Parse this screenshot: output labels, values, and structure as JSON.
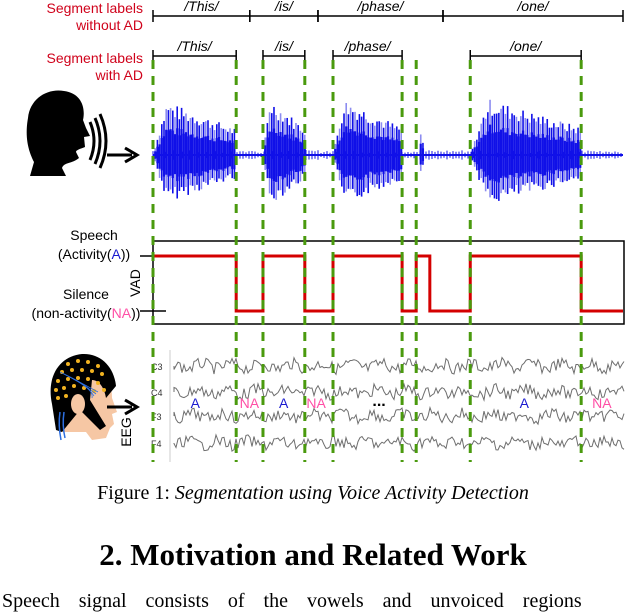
{
  "figure": {
    "row_labels": {
      "without_ad": [
        "Segment labels",
        "without AD"
      ],
      "with_ad": [
        "Segment labels",
        "with AD"
      ]
    },
    "segments_without_ad": [
      {
        "label": "/This/",
        "start": 0.0,
        "end": 0.206
      },
      {
        "label": "/is/",
        "start": 0.206,
        "end": 0.351
      },
      {
        "label": "/phase/",
        "start": 0.351,
        "end": 0.617
      },
      {
        "label": "/one/",
        "start": 0.617,
        "end": 1.0
      }
    ],
    "segments_with_ad": [
      {
        "label": "/This/",
        "start": 0.0,
        "end": 0.177
      },
      {
        "label": "/is/",
        "start": 0.234,
        "end": 0.323
      },
      {
        "label": "/phase/",
        "start": 0.383,
        "end": 0.53
      },
      {
        "label": "/one/",
        "start": 0.675,
        "end": 0.911
      }
    ],
    "boundaries": [
      0.0,
      0.177,
      0.234,
      0.323,
      0.383,
      0.53,
      0.56,
      0.675,
      0.911
    ],
    "vad": {
      "axis_label": "VAD",
      "speech_label": "Speech",
      "activity_label_prefix": "(Activity(",
      "activity_symbol": "A",
      "activity_label_suffix": "))",
      "silence_label": "Silence",
      "nonactivity_label_prefix": "(non-activity(",
      "nonactivity_symbol": "NA",
      "nonactivity_label_suffix": "))",
      "states": [
        {
          "start": 0.0,
          "end": 0.177,
          "value": 1
        },
        {
          "start": 0.177,
          "end": 0.234,
          "value": 0
        },
        {
          "start": 0.234,
          "end": 0.323,
          "value": 1
        },
        {
          "start": 0.323,
          "end": 0.383,
          "value": 0
        },
        {
          "start": 0.383,
          "end": 0.53,
          "value": 1
        },
        {
          "start": 0.53,
          "end": 0.56,
          "value": 0
        },
        {
          "start": 0.56,
          "end": 0.589,
          "value": 1
        },
        {
          "start": 0.589,
          "end": 0.675,
          "value": 0
        },
        {
          "start": 0.675,
          "end": 0.911,
          "value": 1
        },
        {
          "start": 0.911,
          "end": 1.0,
          "value": 0
        }
      ]
    },
    "eeg": {
      "axis_label": "EEG",
      "channels": [
        "C3",
        "C4",
        "F3",
        "F4"
      ],
      "annotations": [
        {
          "text": "A",
          "pos": 0.09,
          "type": "activity"
        },
        {
          "text": "NA",
          "pos": 0.205,
          "type": "nonactivity"
        },
        {
          "text": "A",
          "pos": 0.278,
          "type": "activity"
        },
        {
          "text": "NA",
          "pos": 0.347,
          "type": "nonactivity"
        },
        {
          "text": "...",
          "pos": 0.481,
          "type": "ellipsis"
        },
        {
          "text": "A",
          "pos": 0.79,
          "type": "activity"
        },
        {
          "text": "NA",
          "pos": 0.955,
          "type": "nonactivity"
        }
      ]
    },
    "waveform_bursts": [
      {
        "start": 0.0,
        "end": 0.177,
        "amp": 0.95
      },
      {
        "start": 0.234,
        "end": 0.323,
        "amp": 1.0
      },
      {
        "start": 0.383,
        "end": 0.53,
        "amp": 1.0
      },
      {
        "start": 0.565,
        "end": 0.575,
        "amp": 0.45
      },
      {
        "start": 0.675,
        "end": 0.911,
        "amp": 1.0
      }
    ],
    "colors": {
      "waveform": "#1010e8",
      "waveform_light": "#8c8cf0",
      "boundary": "#4a9a0e",
      "vad_line": "#d40000",
      "activity": "#1a1ad0",
      "nonactivity": "#ff4fa6",
      "label_red": "#d0021b",
      "eeg_trace": "#6e6e6e"
    },
    "caption_prefix": "Figure 1: ",
    "caption_title": "Segmentation using Voice Activity Detection"
  },
  "section_heading": "2.  Motivation and Related Work",
  "body_text_fragment": "Speech signal consists of the vowels and unvoiced regions"
}
